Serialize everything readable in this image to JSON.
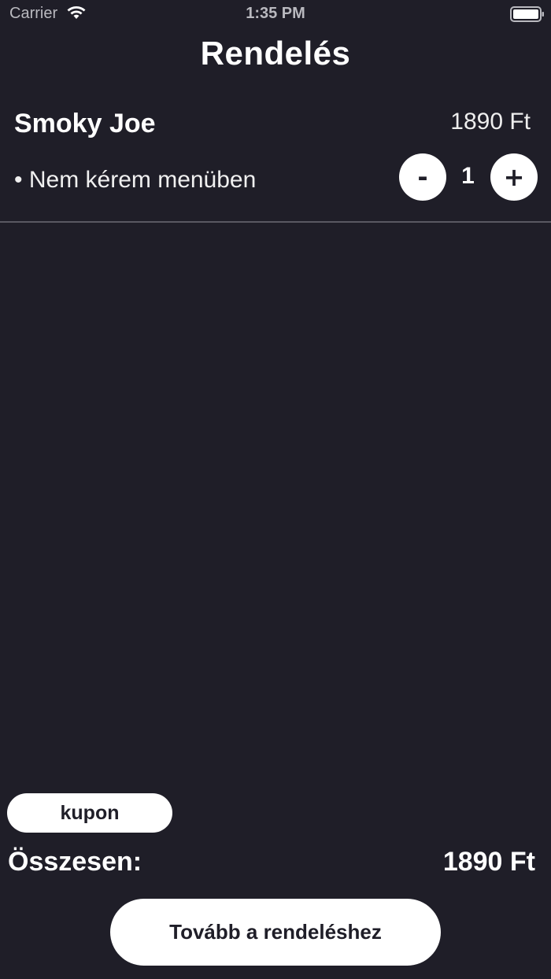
{
  "status_bar": {
    "carrier": "Carrier",
    "time": "1:35 PM",
    "icons": [
      "wifi-icon",
      "battery-icon"
    ]
  },
  "header": {
    "title": "Rendelés"
  },
  "order": {
    "items": [
      {
        "name": "Smoky Joe",
        "price": "1890 Ft",
        "option": "• Nem kérem menüben",
        "quantity": "1",
        "decrement_label": "-",
        "increment_label": "+"
      }
    ]
  },
  "footer": {
    "coupon_label": "kupon",
    "total_label": "Összesen:",
    "total_value": "1890 Ft",
    "continue_label": "Tovább a rendeléshez"
  },
  "colors": {
    "background": "#1f1e28",
    "foreground": "#ffffff",
    "divider": "#5a5962"
  }
}
